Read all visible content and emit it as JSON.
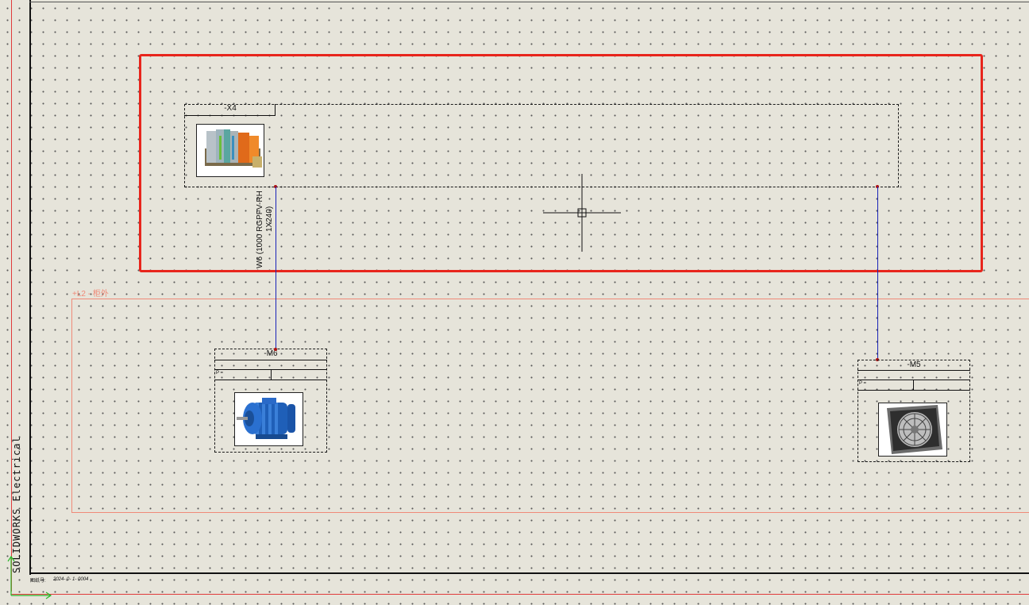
{
  "watermark": "SOLIDWORKS Electrical",
  "location": {
    "label": "+L2 - 柜外"
  },
  "terminal": {
    "tag": "-X4"
  },
  "cable": {
    "line1": "W6 (1000 RGPFV-RH",
    "line2": "1X240)"
  },
  "motor": {
    "tag": "-M6",
    "field_p": "P ="
  },
  "fan": {
    "tag": "-M5",
    "field_p": "P ="
  },
  "footer": {
    "label": "图纸号:",
    "value": "2024- 0- 1- 0004"
  },
  "colors": {
    "background": "#e6e4da",
    "selection_frame": "#e8251c",
    "wire": "#1a23b8",
    "location_border": "#f08a78"
  },
  "icons": [
    "terminal-block-image",
    "motor-image",
    "fan-image",
    "crosshair-cursor-icon",
    "axis-triad-icon"
  ]
}
